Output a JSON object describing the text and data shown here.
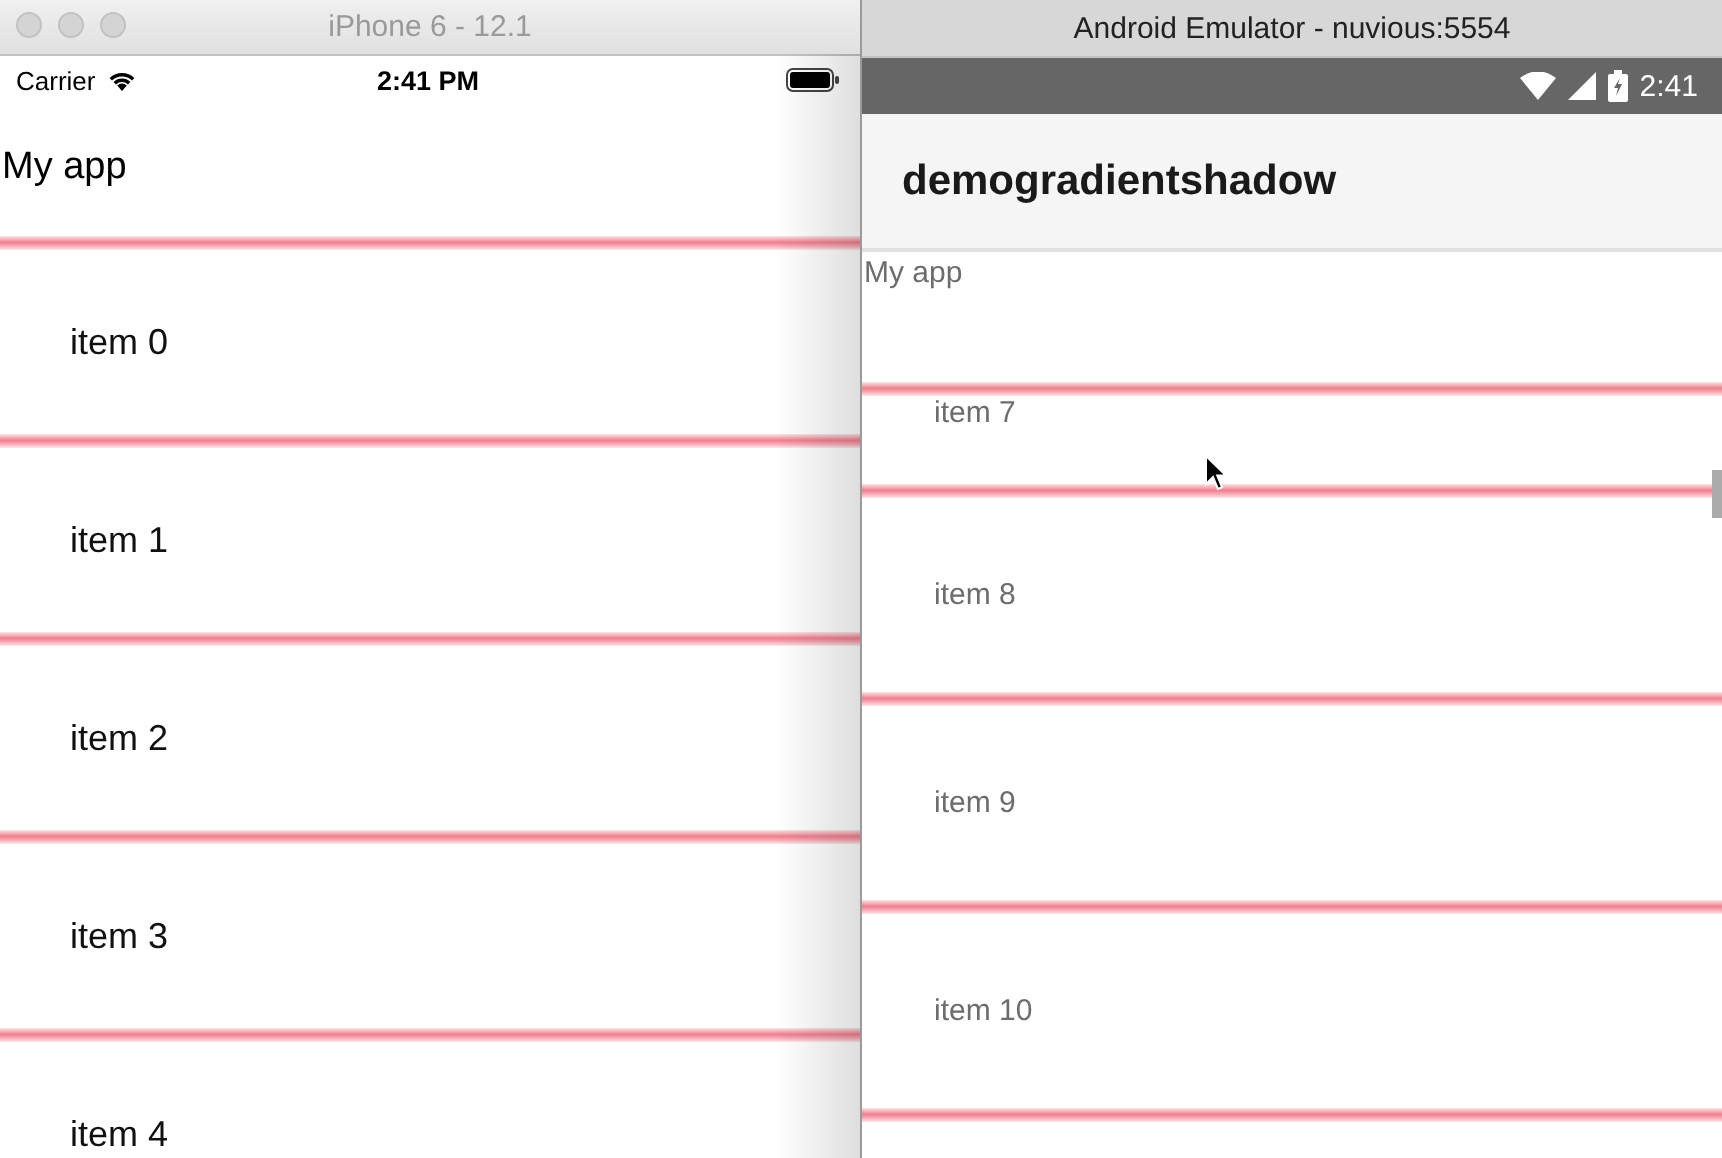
{
  "ios_window": {
    "title": "iPhone 6 - 12.1",
    "status_bar": {
      "carrier": "Carrier",
      "time": "2:41 PM"
    },
    "header": "My app",
    "items": [
      "item 0",
      "item 1",
      "item 2",
      "item 3",
      "item 4"
    ]
  },
  "android_window": {
    "title": "Android Emulator - nuvious:5554",
    "status_bar": {
      "time": "2:41"
    },
    "app_bar": {
      "title": "demogradientshadow"
    },
    "header": "My app",
    "items": [
      "item 7",
      "item 8",
      "item 9",
      "item 10"
    ]
  }
}
